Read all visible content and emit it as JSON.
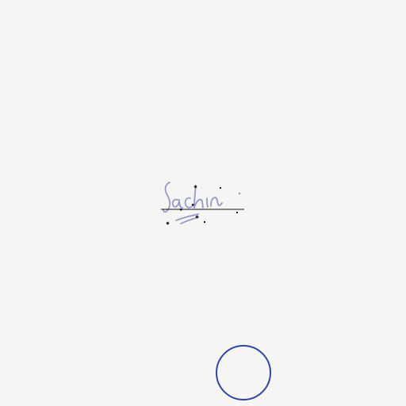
{
  "signature": {
    "text": "Sachin.",
    "ink_color": "#8c8fc2",
    "line_color": "#111111"
  },
  "stamp": {
    "shape": "circle",
    "color": "#2f46a3"
  },
  "background_color": "#f5f5f3"
}
